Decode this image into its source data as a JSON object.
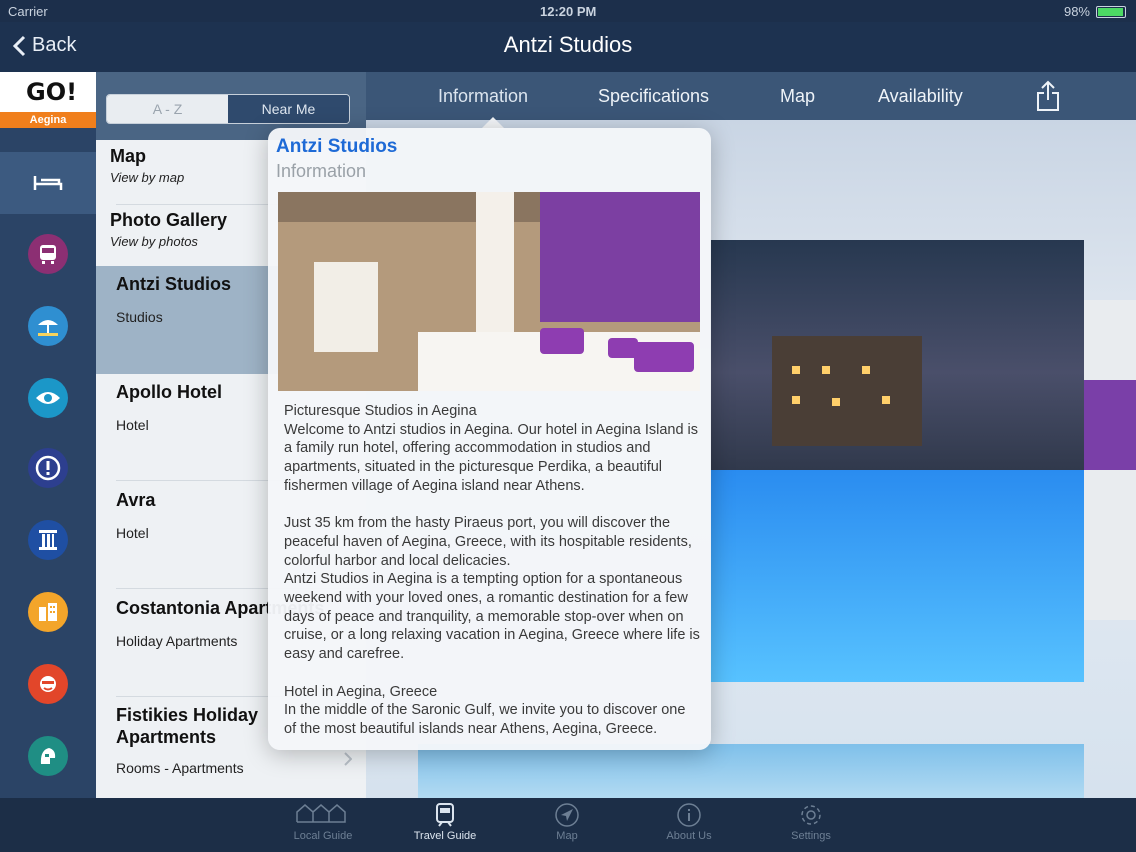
{
  "status": {
    "carrier": "Carrier",
    "time": "12:20 PM",
    "battery": "98%"
  },
  "nav": {
    "back_label": "Back",
    "title": "Antzi Studios"
  },
  "logo": {
    "text": "GO!",
    "tag": "Aegina"
  },
  "segment": {
    "a_z": "A - Z",
    "near_me": "Near Me"
  },
  "list": {
    "map": {
      "title": "Map",
      "subtitle": "View by map"
    },
    "gallery": {
      "title": "Photo Gallery",
      "subtitle": "View by photos"
    },
    "items": [
      {
        "title": "Antzi Studios",
        "subtitle": "Studios"
      },
      {
        "title": "Apollo Hotel",
        "subtitle": "Hotel"
      },
      {
        "title": "Avra",
        "subtitle": "Hotel"
      },
      {
        "title": "Costantonia Apartments",
        "subtitle": "Holiday Apartments"
      },
      {
        "title": "Fistikies Holiday Apartments",
        "subtitle": "Rooms - Apartments"
      }
    ]
  },
  "tabs": {
    "information": "Information",
    "specifications": "Specifications",
    "map": "Map",
    "availability": "Availability"
  },
  "popover": {
    "title": "Antzi Studios",
    "subtitle": "Information",
    "body": "Picturesque Studios in Aegina\nWelcome to Antzi studios in Aegina. Our hotel in Aegina Island is a family run hotel, offering accommodation in studios and apartments, situated in the picturesque Perdika, a beautiful fishermen village of Aegina island near Athens.\n\nJust 35 km from the hasty Piraeus port, you will discover the peaceful haven of Aegina, Greece, with its hospitable residents, colorful harbor and local delicacies.\nAntzi Studios in Aegina is a tempting option for a spontaneous weekend with your loved ones, a romantic destination for a few days of peace and tranquility, a memorable stop-over when on cruise, or a long relaxing vacation in Aegina, Greece where life is easy and carefree.\n\nHotel in Aegina, Greece\nIn the middle of the Saronic Gulf, we invite you to discover one of the most beautiful islands near Athens, Aegina, Greece."
  },
  "tabbar": [
    {
      "label": "Local Guide",
      "icon": "houses-icon"
    },
    {
      "label": "Travel Guide",
      "icon": "train-icon"
    },
    {
      "label": "Map",
      "icon": "navigation-icon"
    },
    {
      "label": "About Us",
      "icon": "info-icon"
    },
    {
      "label": "Settings",
      "icon": "gear-icon"
    }
  ],
  "rail_icons": [
    "bed-icon",
    "bus-icon",
    "beach-icon",
    "eye-icon",
    "alert-icon",
    "column-icon",
    "buildings-icon",
    "person-icon",
    "helmet-icon"
  ],
  "colors": {
    "accent_blue": "#1e6ad6",
    "orange": "#f07f1c",
    "navy": "#1d3250"
  }
}
